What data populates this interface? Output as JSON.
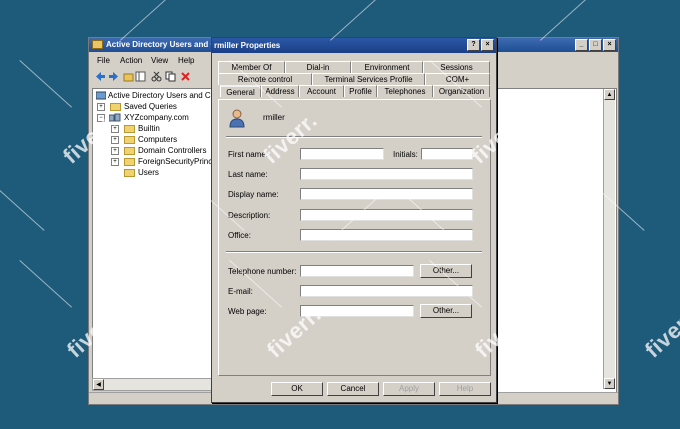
{
  "aduc": {
    "title": "Active Directory Users and Computers",
    "menus": [
      "File",
      "Action",
      "View",
      "Help"
    ],
    "tree": {
      "root": "Active Directory Users and Computers",
      "saved_queries": "Saved Queries",
      "domain": "XYZcompany.com",
      "children": [
        "Builtin",
        "Computers",
        "Domain Controllers",
        "ForeignSecurityPrincipals",
        "Users"
      ]
    }
  },
  "dialog": {
    "title": "rmiller Properties",
    "tabs_row1": [
      "Member Of",
      "Dial-in",
      "Environment",
      "Sessions"
    ],
    "tabs_row2": [
      "Remote control",
      "Terminal Services Profile",
      "COM+"
    ],
    "tabs_row3": [
      "General",
      "Address",
      "Account",
      "Profile",
      "Telephones",
      "Organization"
    ],
    "active_tab": "General",
    "username": "rmiller",
    "labels": {
      "first_name": "First name:",
      "initials": "Initials:",
      "last_name": "Last name:",
      "display_name": "Display name:",
      "description": "Description:",
      "office": "Office:",
      "telephone": "Telephone number:",
      "email": "E-mail:",
      "web_page": "Web page:"
    },
    "values": {
      "first_name": "",
      "initials": "",
      "last_name": "",
      "display_name": "",
      "description": "",
      "office": "",
      "telephone": "",
      "email": "",
      "web_page": ""
    },
    "buttons": {
      "other1": "Other...",
      "other2": "Other...",
      "ok": "OK",
      "cancel": "Cancel",
      "apply": "Apply",
      "help": "Help"
    }
  },
  "watermark": "fiverr."
}
